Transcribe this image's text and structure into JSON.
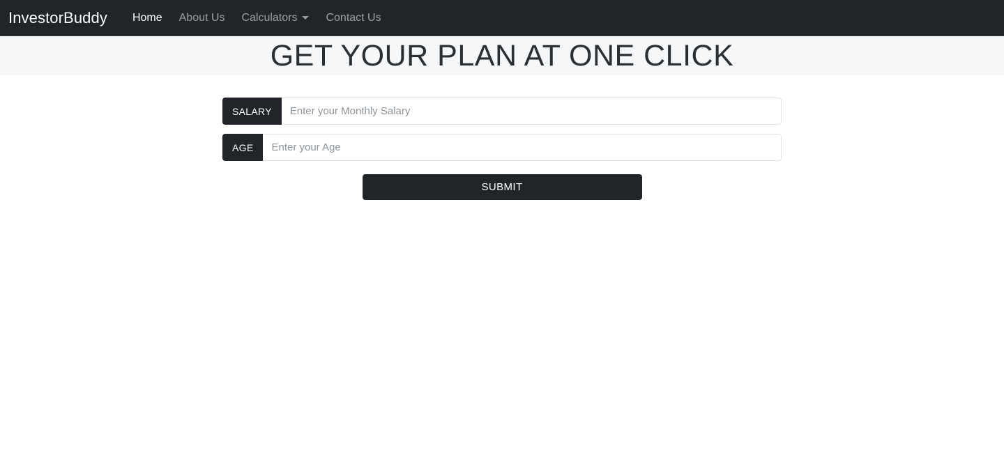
{
  "navbar": {
    "brand": "InvestorBuddy",
    "links": [
      {
        "label": "Home",
        "active": true,
        "has_caret": false
      },
      {
        "label": "About Us",
        "active": false,
        "has_caret": false
      },
      {
        "label": "Calculators",
        "active": false,
        "has_caret": true
      },
      {
        "label": "Contact Us",
        "active": false,
        "has_caret": false
      }
    ],
    "background_color": "#212529",
    "active_link_color": "#ffffff",
    "inactive_link_color": "rgba(255,255,255,0.55)",
    "caret_icon": "chevron-down-icon"
  },
  "hero": {
    "title": "GET YOUR PLAN AT ONE CLICK",
    "background_color": "#f6f7f9",
    "title_color": "#2b2f33"
  },
  "form": {
    "fields": [
      {
        "label": "SALARY",
        "placeholder": "Enter your Monthly Salary",
        "value": ""
      },
      {
        "label": "AGE",
        "placeholder": "Enter your Age",
        "value": ""
      }
    ],
    "submit_label": "SUBMIT",
    "label_background": "#212529",
    "label_text_color": "#ffffff",
    "input_border_color": "#dfe3e8",
    "placeholder_color": "#8e959c",
    "submit_background": "#212529",
    "submit_text_color": "#ffffff"
  }
}
